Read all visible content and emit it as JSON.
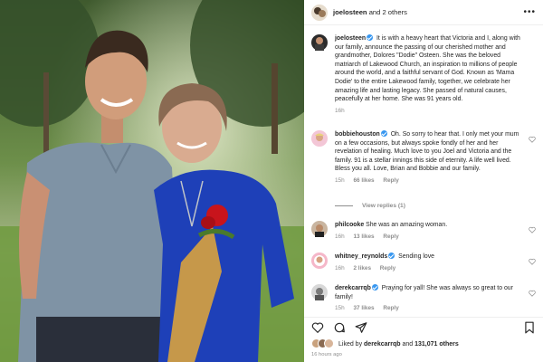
{
  "header": {
    "username": "joelosteen",
    "suffix": "and 2 others"
  },
  "caption": {
    "username": "joelosteen",
    "text": "It is with a heavy heart that Victoria and I, along with our family, announce the passing of our cherished mother and grandmother, Dolores \"Dodie\" Osteen.  She was the beloved matriarch of Lakewood Church, an inspiration to millions of people around the world, and a faithful servant of God.  Known as 'Mama Dodie' to the entire Lakewood family, together, we celebrate her amazing life and lasting legacy. She passed of natural causes, peacefully at her home. She was 91 years old.",
    "time": "16h"
  },
  "comments": [
    {
      "username": "bobbiehouston",
      "verified": true,
      "text": "Oh. So sorry to hear that. I only met your mum on a few occasions, but always spoke fondly of her and her revelation of healing. Much love to you Joel and Victoria and the family. 91 is a stellar innings this side of eternity. A life well lived. Bless you all. Love, Brian and Bobbie and our family.",
      "time": "15h",
      "likes": "66 likes",
      "reply": "Reply",
      "view_replies": "View replies (1)"
    },
    {
      "username": "philcooke",
      "verified": false,
      "text": "She was an amazing woman.",
      "time": "16h",
      "likes": "13 likes",
      "reply": "Reply"
    },
    {
      "username": "whitney_reynolds",
      "verified": true,
      "text": "Sending love",
      "time": "16h",
      "likes": "2 likes",
      "reply": "Reply"
    },
    {
      "username": "derekcarrqb",
      "verified": true,
      "text": "Praying for yall! She was always so great to our family!",
      "time": "15h",
      "likes": "37 likes",
      "reply": "Reply"
    }
  ],
  "likes": {
    "prefix": "Liked by",
    "user": "derekcarrqb",
    "middle": "and",
    "count": "131,071 others"
  },
  "time_ago": "16 hours ago",
  "colors": {
    "verified": "#3897f0",
    "meta_grey": "#8e8e8e",
    "text": "#262626"
  },
  "icons": [
    "more-icon",
    "heart-icon",
    "comment-icon",
    "share-icon",
    "bookmark-icon"
  ]
}
